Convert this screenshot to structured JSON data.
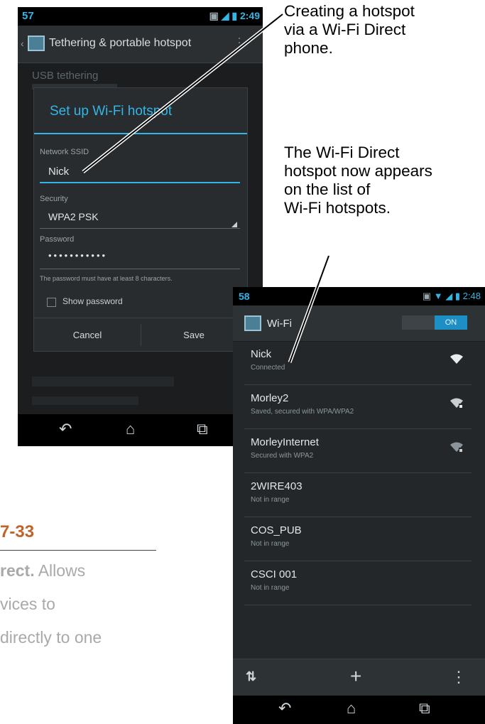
{
  "phone1": {
    "status": {
      "number": "57",
      "time": "2:49"
    },
    "action_bar": {
      "title": "Tethering & portable hotspot"
    },
    "background_item": "USB tethering",
    "dialog": {
      "title": "Set up Wi-Fi hotspot",
      "ssid_label": "Network SSID",
      "ssid_value": "Nick",
      "security_label": "Security",
      "security_value": "WPA2 PSK",
      "password_label": "Password",
      "password_value": "•••••••••••",
      "password_hint": "The password must have at least 8 characters.",
      "show_password_label": "Show password",
      "cancel_label": "Cancel",
      "save_label": "Save"
    }
  },
  "phone2": {
    "status": {
      "number": "58",
      "time": "2:48"
    },
    "action_bar": {
      "title": "Wi-Fi",
      "toggle_label": "ON"
    },
    "networks": [
      {
        "name": "Nick",
        "status": "Connected",
        "signal_icon": "wifi-signal-icon"
      },
      {
        "name": "Morley2",
        "status": "Saved, secured with WPA/WPA2",
        "signal_icon": "wifi-locked-icon"
      },
      {
        "name": "MorleyInternet",
        "status": "Secured with WPA2",
        "signal_icon": "wifi-locked-icon"
      },
      {
        "name": "2WIRE403",
        "status": "Not in range"
      },
      {
        "name": "COS_PUB",
        "status": "Not in range"
      },
      {
        "name": "CSCI 001",
        "status": "Not in range"
      }
    ],
    "bottom_bar": {
      "scan_icon": "scan-icon",
      "add_icon": "add-icon",
      "overflow_icon": "overflow-menu-icon"
    }
  },
  "callouts": {
    "top": [
      "Creating a hotspot",
      "via a Wi-Fi Direct",
      "phone."
    ],
    "middle": [
      "The Wi-Fi Direct",
      "hotspot now appears",
      "on the list of",
      "Wi-Fi hotspots."
    ]
  },
  "book": {
    "figure_number": "7-33",
    "line1_bold": "rect.",
    "line1_rest": " Allows",
    "line2": "vices to",
    "line3": "directly to one"
  }
}
